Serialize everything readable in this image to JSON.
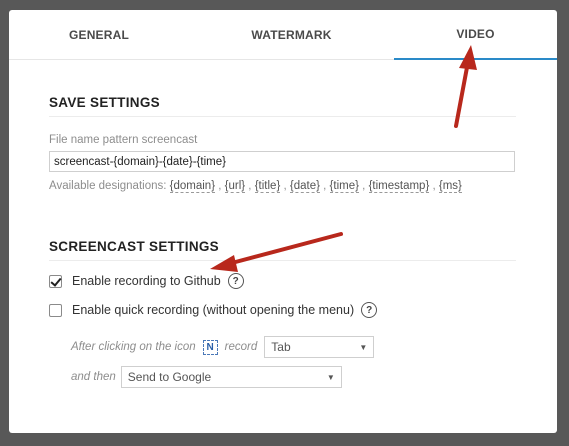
{
  "tabs": [
    {
      "label": "GENERAL",
      "active": false
    },
    {
      "label": "WATERMARK",
      "active": false
    },
    {
      "label": "VIDEO",
      "active": true
    }
  ],
  "save_settings": {
    "title": "SAVE SETTINGS",
    "file_name_label": "File name pattern screencast",
    "file_name_value": "screencast-{domain}-{date}-{time}",
    "designations_label": "Available designations:",
    "designations": [
      "{domain}",
      "{url}",
      "{title}",
      "{date}",
      "{time}",
      "{timestamp}",
      "{ms}"
    ]
  },
  "screencast_settings": {
    "title": "SCREENCAST SETTINGS",
    "enable_github": {
      "label": "Enable recording to Github",
      "checked": true
    },
    "enable_quick": {
      "label": "Enable quick recording (without opening the menu)",
      "checked": false
    },
    "after_clicking_label": "After clicking on the icon",
    "icon_glyph": "N",
    "record_label": "record",
    "record_select_value": "Tab",
    "and_then_label": "and then",
    "and_then_select_value": "Send to Google"
  },
  "colors": {
    "accent": "#2a8ac8",
    "arrow": "#b8281c",
    "backdrop": "#585858"
  }
}
